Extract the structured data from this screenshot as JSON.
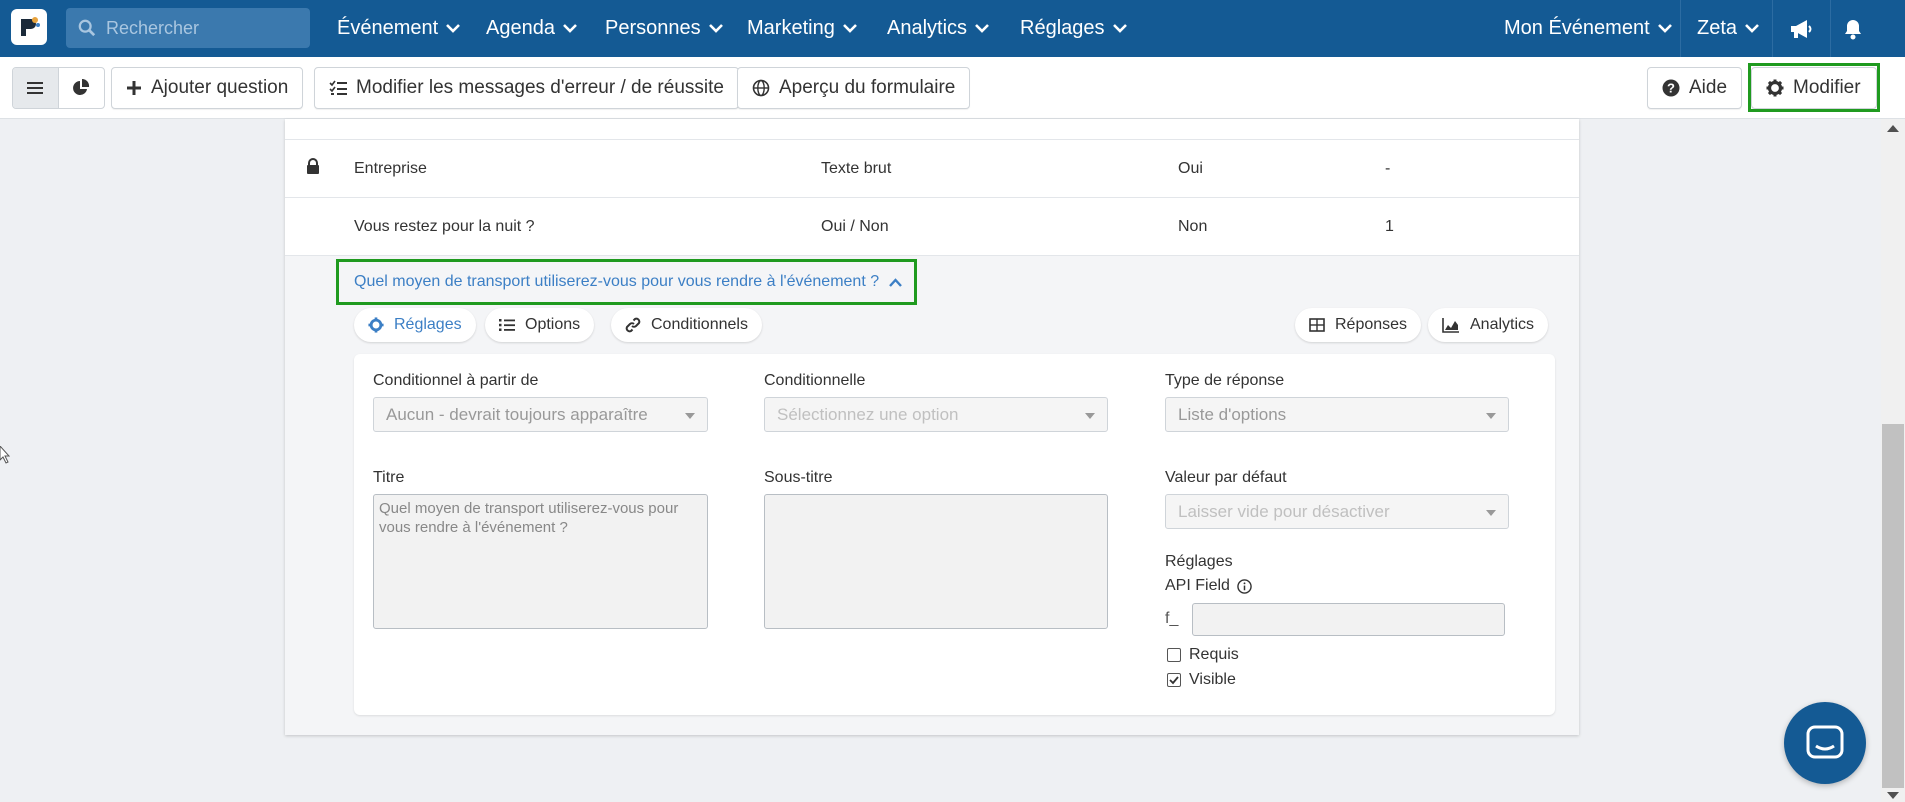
{
  "navbar": {
    "search_placeholder": "Rechercher",
    "menu": [
      "Événement",
      "Agenda",
      "Personnes",
      "Marketing",
      "Analytics",
      "Réglages"
    ],
    "event_switcher": "Mon Événement",
    "user": "Zeta",
    "bg_color": "#145a94"
  },
  "toolbar": {
    "add_question": "Ajouter question",
    "edit_messages": "Modifier les messages d'erreur / de réussite",
    "preview": "Aperçu du formulaire",
    "help": "Aide",
    "edit": "Modifier"
  },
  "table": {
    "rows": [
      {
        "locked": true,
        "name": "Entreprise",
        "type": "Texte brut",
        "required": "Oui",
        "value": "-"
      },
      {
        "locked": false,
        "name": "Vous restez pour la nuit ?",
        "type": "Oui / Non",
        "required": "Non",
        "value": "1"
      }
    ]
  },
  "question": {
    "title": "Quel moyen de transport utiliserez-vous pour vous rendre à l'événement ?",
    "tabs": {
      "settings": "Réglages",
      "options": "Options",
      "conditionals": "Conditionnels"
    },
    "side_tabs": {
      "responses": "Réponses",
      "analytics": "Analytics"
    },
    "form": {
      "conditional_from_label": "Conditionnel à partir de",
      "conditional_from_value": "Aucun - devrait toujours apparaître",
      "conditional_label": "Conditionnelle",
      "conditional_placeholder": "Sélectionnez une option",
      "response_type_label": "Type de réponse",
      "response_type_value": "Liste d'options",
      "title_label": "Titre",
      "title_value": "Quel moyen de transport utiliserez-vous pour vous rendre à l'événement ?",
      "subtitle_label": "Sous-titre",
      "subtitle_value": "",
      "default_label": "Valeur par défaut",
      "default_placeholder": "Laisser vide pour désactiver",
      "settings_label": "Réglages",
      "api_field_label": "API Field",
      "api_prefix": "f_",
      "required_label": "Requis",
      "required_checked": false,
      "visible_label": "Visible",
      "visible_checked": true
    }
  },
  "colors": {
    "highlight": "#1f9a1f",
    "link": "#3c7fc5"
  }
}
